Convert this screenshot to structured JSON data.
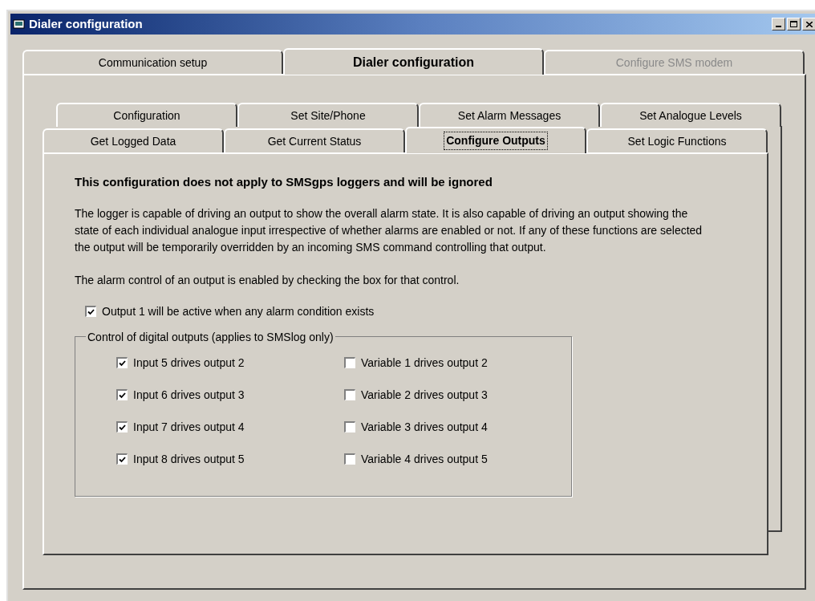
{
  "window": {
    "title": "Dialer configuration"
  },
  "main_tabs": [
    {
      "label": "Communication setup",
      "selected": false,
      "disabled": false
    },
    {
      "label": "Dialer configuration",
      "selected": true,
      "disabled": false
    },
    {
      "label": "Configure SMS modem",
      "selected": false,
      "disabled": true
    }
  ],
  "sub_tabs_back": [
    {
      "label": "Configuration",
      "selected": false
    },
    {
      "label": "Set Site/Phone",
      "selected": false
    },
    {
      "label": "Set Alarm Messages",
      "selected": false
    },
    {
      "label": "Set Analogue Levels",
      "selected": false
    }
  ],
  "sub_tabs_front": [
    {
      "label": "Get Logged Data",
      "selected": false
    },
    {
      "label": "Get Current Status",
      "selected": false
    },
    {
      "label": "Configure Outputs",
      "selected": true
    },
    {
      "label": "Set Logic Functions",
      "selected": false
    }
  ],
  "panel": {
    "heading": "This configuration does not apply to SMSgps loggers and will be ignored",
    "paragraphs": [
      "The logger is capable of driving an output to show the overall alarm state.  It is also capable of driving an output showing the state of each individual analogue input irrespective of whether alarms are enabled or not.  If any of these functions are selected the output will be temporarily overridden by an incoming SMS command controlling that output.",
      "The alarm control of an output is enabled by checking the box for that control."
    ],
    "alarm_checkbox": {
      "label": "Output 1 will be active when any alarm condition exists",
      "checked": true
    },
    "group": {
      "title": "Control of digital outputs (applies to SMSlog only)",
      "rows": [
        {
          "input": {
            "label": "Input 5 drives output 2",
            "checked": true
          },
          "variable": {
            "label": "Variable 1 drives output 2",
            "checked": false
          }
        },
        {
          "input": {
            "label": "Input 6 drives output 3",
            "checked": true
          },
          "variable": {
            "label": "Variable 2 drives output 3",
            "checked": false
          }
        },
        {
          "input": {
            "label": "Input 7 drives output 4",
            "checked": true
          },
          "variable": {
            "label": "Variable 3 drives output 4",
            "checked": false
          }
        },
        {
          "input": {
            "label": "Input 8 drives output 5",
            "checked": true
          },
          "variable": {
            "label": "Variable 4 drives output 5",
            "checked": false
          }
        }
      ]
    }
  }
}
